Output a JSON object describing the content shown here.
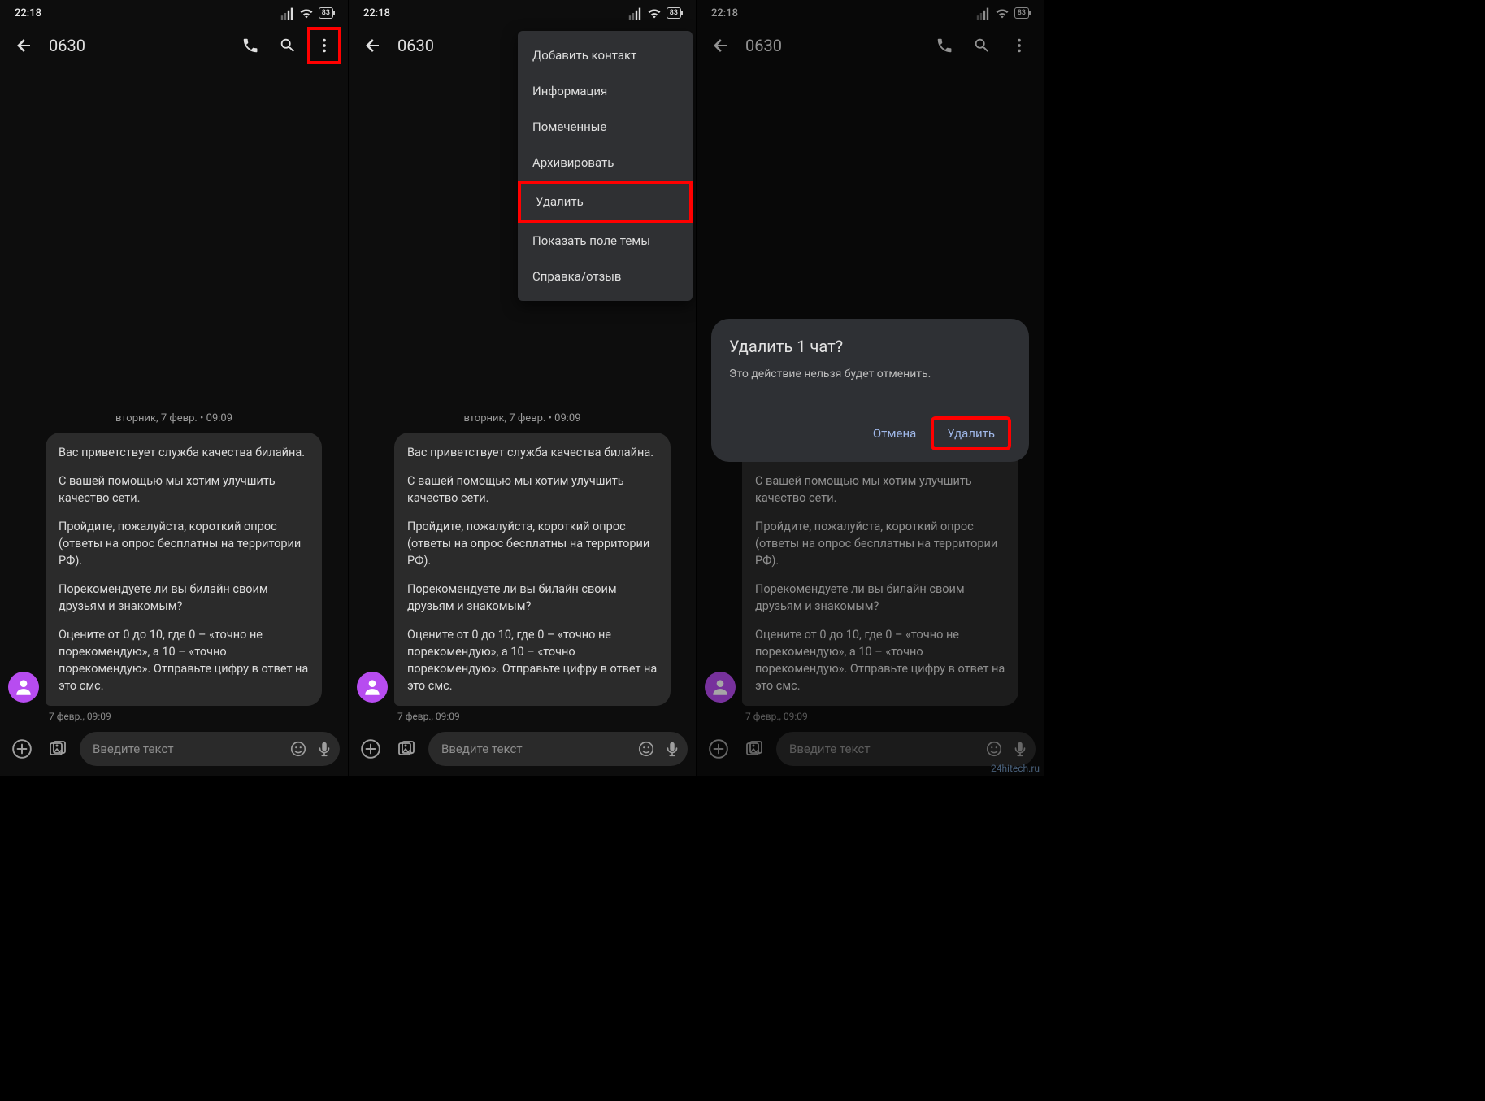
{
  "status": {
    "time": "22:18",
    "battery": "83"
  },
  "header": {
    "title": "0630"
  },
  "thread": {
    "date_divider": "вторник, 7 февр. • 09:09",
    "msg": {
      "p1": "Вас приветствует служба качества билайна.",
      "p2": "С вашей помощью мы хотим улучшить качество сети.",
      "p3": "Пройдите, пожалуйста, короткий опрос (ответы на опрос бесплатны на территории РФ).",
      "p4": "Порекомендуете ли вы билайн своим друзьям и знакомым?",
      "p5": "Оцените от 0 до 10, где 0 – «точно не порекомендую», а 10 – «точно порекомендую». Отправьте цифру в ответ на это смс.",
      "time": "7 февр., 09:09"
    }
  },
  "compose": {
    "placeholder": "Введите текст"
  },
  "menu": {
    "add_contact": "Добавить контакт",
    "info": "Информация",
    "starred": "Помеченные",
    "archive": "Архивировать",
    "delete": "Удалить",
    "show_subject": "Показать поле темы",
    "help": "Справка/отзыв"
  },
  "dialog": {
    "title": "Удалить 1 чат?",
    "message": "Это действие нельзя будет отменить.",
    "cancel": "Отмена",
    "confirm": "Удалить"
  },
  "watermark": "24hitech.ru"
}
